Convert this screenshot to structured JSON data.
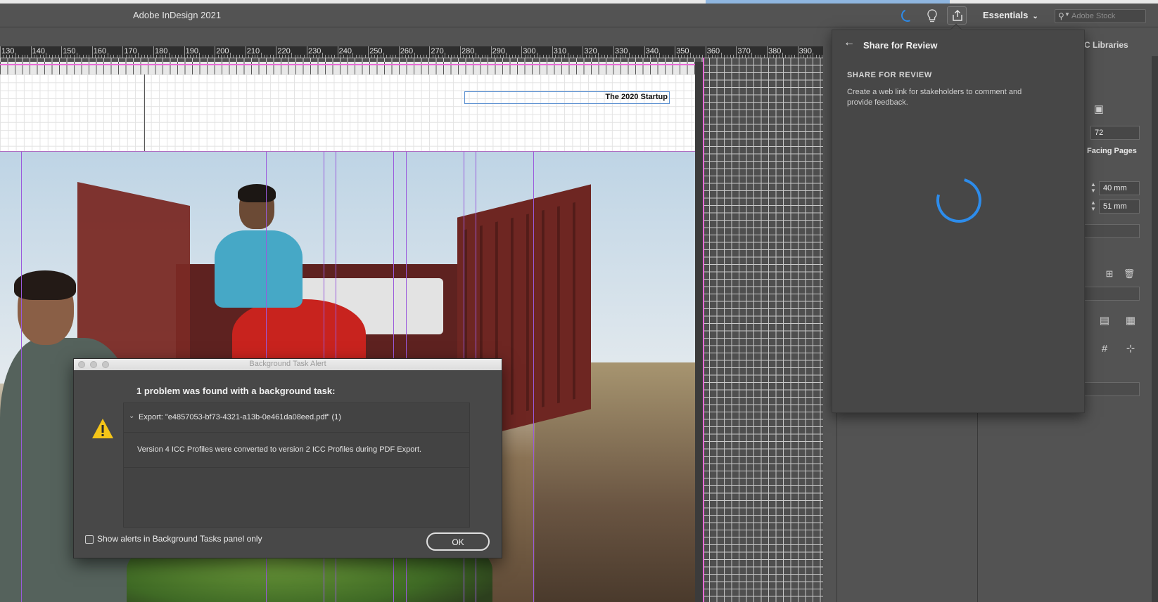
{
  "app": {
    "title": "Adobe InDesign 2021"
  },
  "toolbar": {
    "workspace_label": "Essentials",
    "stock_search_placeholder": "Adobe Stock"
  },
  "ruler": {
    "labels": [
      "130",
      "140",
      "150",
      "160",
      "170",
      "180",
      "190",
      "200",
      "210",
      "220",
      "230",
      "240",
      "250",
      "260",
      "270",
      "280",
      "290",
      "300",
      "310",
      "320",
      "330",
      "340",
      "350",
      "360",
      "370",
      "380",
      "390"
    ]
  },
  "document": {
    "header_text": "The 2020 Startup"
  },
  "alert": {
    "window_title": "Background Task Alert",
    "headline": "1 problem was found with a background task:",
    "task_label": "Export: \"e4857053-bf73-4321-a13b-0e461da08eed.pdf\" (1)",
    "message": "Version 4 ICC Profiles were converted to version 2 ICC Profiles during PDF Export.",
    "checkbox_label": "Show alerts in Background Tasks panel only",
    "checkbox_checked": false,
    "ok_label": "OK"
  },
  "share_panel": {
    "title": "Share for Review",
    "heading": "SHARE FOR REVIEW",
    "description": "Create a web link for stakeholders to comment and provide feedback.",
    "loading": true,
    "accent_color": "#2d8ceb"
  },
  "right_panel": {
    "libraries_tab": "C Libraries",
    "field_resolution": "72",
    "facing_pages_label": "Facing Pages",
    "field_width": "40 mm",
    "field_height": "51 mm"
  },
  "colors": {
    "chrome": "#535353",
    "guide_pink": "#e86ad6",
    "guide_purple": "#9a5adc",
    "frame_blue": "#5a8fd0"
  }
}
